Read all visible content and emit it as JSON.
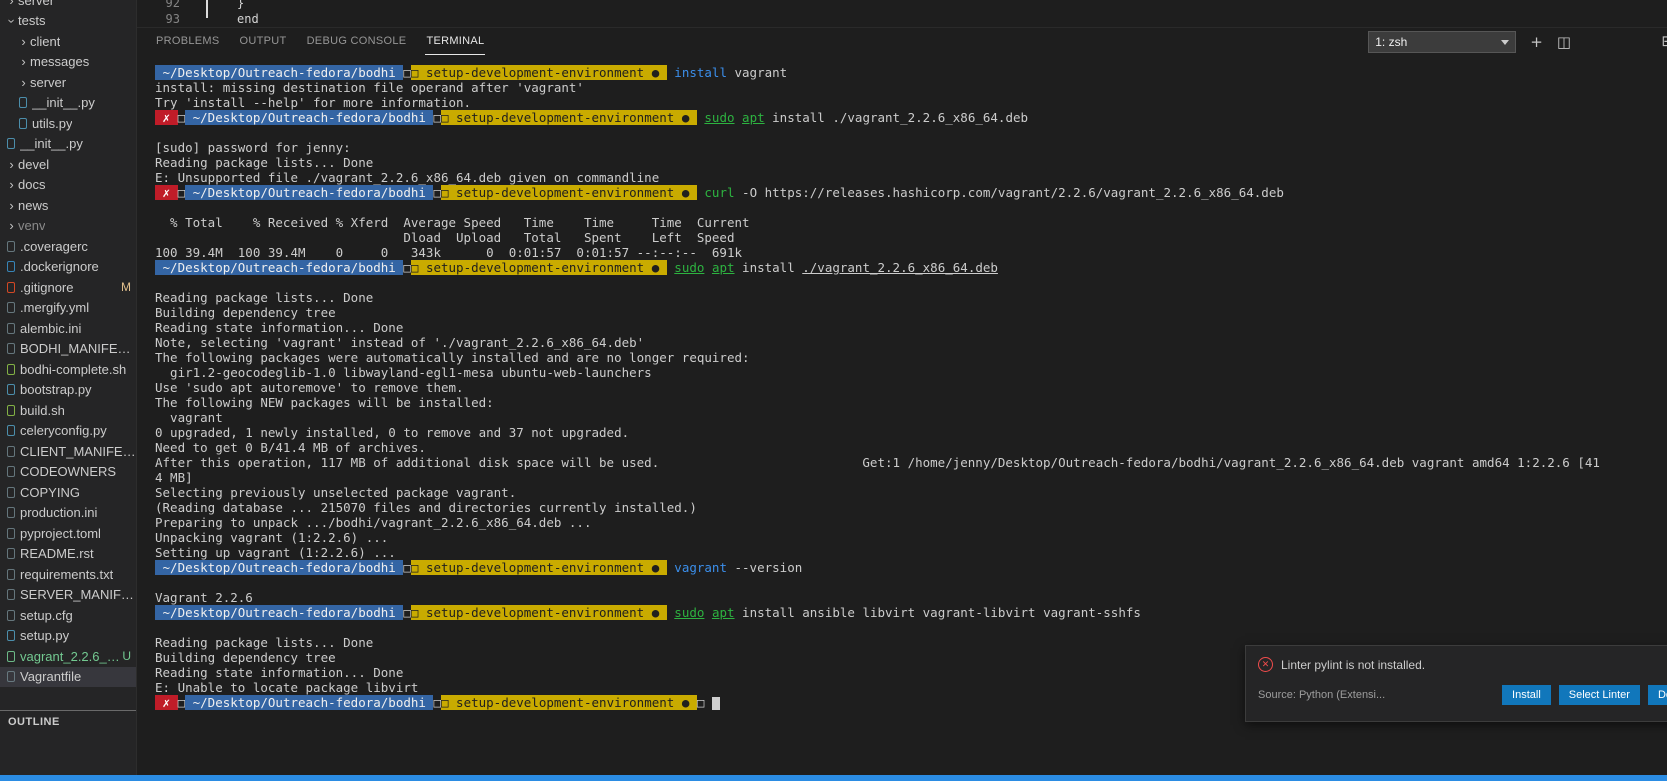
{
  "colors": {
    "prompt_blue": "#3465a4",
    "prompt_yellow": "#c9ab00",
    "prompt_red": "#c01c28",
    "ansi_green": "#2db340",
    "ansi_blue": "#3b8eea",
    "statusbar_blue": "#2b8ce3",
    "button_blue": "#1177bb",
    "error_red": "#f14c4c",
    "git_modified": "#e2c08d",
    "git_untracked": "#73c991"
  },
  "icons": {
    "new_terminal_icon": "+",
    "split_terminal_icon": "◫",
    "maximize_panel_icon": "⊞"
  },
  "sidebar": {
    "outline_label": "OUTLINE",
    "files": [
      {
        "label": "server",
        "kind": "folder",
        "indent": 0
      },
      {
        "label": "tests",
        "kind": "folder",
        "indent": 0,
        "expanded": true
      },
      {
        "label": "client",
        "kind": "folder",
        "indent": 1
      },
      {
        "label": "messages",
        "kind": "folder",
        "indent": 1
      },
      {
        "label": "server",
        "kind": "folder",
        "indent": 1
      },
      {
        "label": "__init__.py",
        "kind": "file",
        "indent": 1,
        "icon": "python-file-icon",
        "icon_color": "#519aba"
      },
      {
        "label": "utils.py",
        "kind": "file",
        "indent": 1,
        "icon": "python-file-icon",
        "icon_color": "#519aba"
      },
      {
        "label": "__init__.py",
        "kind": "file",
        "indent": 0,
        "icon": "python-file-icon",
        "icon_color": "#519aba"
      },
      {
        "label": "devel",
        "kind": "folder",
        "indent": 0
      },
      {
        "label": "docs",
        "kind": "folder",
        "indent": 0
      },
      {
        "label": "news",
        "kind": "folder",
        "indent": 0
      },
      {
        "label": "venv",
        "kind": "folder",
        "indent": 0,
        "dim": true
      },
      {
        "label": ".coveragerc",
        "kind": "file",
        "indent": 0,
        "icon": "config-file-icon",
        "icon_color": "#6d8086"
      },
      {
        "label": ".dockerignore",
        "kind": "file",
        "indent": 0,
        "icon": "docker-icon",
        "icon_color": "#3a8fc6"
      },
      {
        "label": ".gitignore",
        "kind": "file",
        "indent": 0,
        "icon": "git-icon",
        "icon_color": "#e44d26",
        "badge": "M",
        "badge_color": "#e2c08d"
      },
      {
        "label": ".mergify.yml",
        "kind": "file",
        "indent": 0,
        "icon": "yaml-file-icon",
        "icon_color": "#6d8086"
      },
      {
        "label": "alembic.ini",
        "kind": "file",
        "indent": 0,
        "icon": "config-file-icon",
        "icon_color": "#6d8086"
      },
      {
        "label": "BODHI_MANIFEST.in",
        "kind": "file",
        "indent": 0,
        "icon": "text-file-icon",
        "icon_color": "#6d8086"
      },
      {
        "label": "bodhi-complete.sh",
        "kind": "file",
        "indent": 0,
        "icon": "shell-script-icon",
        "icon_color": "#8dc149"
      },
      {
        "label": "bootstrap.py",
        "kind": "file",
        "indent": 0,
        "icon": "python-file-icon",
        "icon_color": "#519aba"
      },
      {
        "label": "build.sh",
        "kind": "file",
        "indent": 0,
        "icon": "shell-script-icon",
        "icon_color": "#8dc149"
      },
      {
        "label": "celeryconfig.py",
        "kind": "file",
        "indent": 0,
        "icon": "python-file-icon",
        "icon_color": "#519aba"
      },
      {
        "label": "CLIENT_MANIFEST.in",
        "kind": "file",
        "indent": 0,
        "icon": "text-file-icon",
        "icon_color": "#6d8086"
      },
      {
        "label": "CODEOWNERS",
        "kind": "file",
        "indent": 0,
        "icon": "text-file-icon",
        "icon_color": "#6d8086"
      },
      {
        "label": "COPYING",
        "kind": "file",
        "indent": 0,
        "icon": "text-file-icon",
        "icon_color": "#6d8086"
      },
      {
        "label": "production.ini",
        "kind": "file",
        "indent": 0,
        "icon": "config-file-icon",
        "icon_color": "#6d8086"
      },
      {
        "label": "pyproject.toml",
        "kind": "file",
        "indent": 0,
        "icon": "config-file-icon",
        "icon_color": "#6d8086"
      },
      {
        "label": "README.rst",
        "kind": "file",
        "indent": 0,
        "icon": "text-file-icon",
        "icon_color": "#6d8086"
      },
      {
        "label": "requirements.txt",
        "kind": "file",
        "indent": 0,
        "icon": "text-file-icon",
        "icon_color": "#6d8086"
      },
      {
        "label": "SERVER_MANIFEST.in",
        "kind": "file",
        "indent": 0,
        "icon": "text-file-icon",
        "icon_color": "#6d8086"
      },
      {
        "label": "setup.cfg",
        "kind": "file",
        "indent": 0,
        "icon": "config-file-icon",
        "icon_color": "#6d8086"
      },
      {
        "label": "setup.py",
        "kind": "file",
        "indent": 0,
        "icon": "python-file-icon",
        "icon_color": "#519aba"
      },
      {
        "label": "vagrant_2.2.6_x...",
        "kind": "file",
        "indent": 0,
        "icon": "package-file-icon",
        "icon_color": "#73c991",
        "badge": "U",
        "badge_color": "#73c991",
        "color": "#73c991"
      },
      {
        "label": "Vagrantfile",
        "kind": "file",
        "indent": 0,
        "icon": "ruby-file-icon",
        "icon_color": "#6d8086",
        "selected": true
      }
    ]
  },
  "editor": {
    "lines": [
      {
        "num": "92",
        "text": "}"
      },
      {
        "num": "93",
        "text": "end"
      }
    ]
  },
  "panel": {
    "tabs": [
      "PROBLEMS",
      "OUTPUT",
      "DEBUG CONSOLE",
      "TERMINAL"
    ],
    "active_tab": "TERMINAL",
    "shell_selector": "1: zsh"
  },
  "terminal": {
    "lines": [
      {
        "spans": [
          {
            "c": "b",
            "t": " ~/Desktop/Outreach-fedora/bodhi "
          },
          {
            "c": "p",
            "t": "□"
          },
          {
            "c": "y",
            "t": "□ setup-development-environment ● "
          },
          {
            "c": "p",
            "t": " "
          },
          {
            "c": "blu",
            "t": "install"
          },
          {
            "c": "p",
            "t": " vagrant"
          }
        ]
      },
      {
        "spans": [
          {
            "c": "p",
            "t": "install: missing destination file operand after 'vagrant'"
          }
        ]
      },
      {
        "spans": [
          {
            "c": "p",
            "t": "Try 'install --help' for more information."
          }
        ]
      },
      {
        "spans": [
          {
            "c": "r",
            "t": " ✗ "
          },
          {
            "c": "p",
            "t": "□"
          },
          {
            "c": "b",
            "t": " ~/Desktop/Outreach-fedora/bodhi "
          },
          {
            "c": "p",
            "t": "□"
          },
          {
            "c": "y",
            "t": "□ setup-development-environment ● "
          },
          {
            "c": "p",
            "t": " "
          },
          {
            "c": "grnU",
            "t": "sudo"
          },
          {
            "c": "p",
            "t": " "
          },
          {
            "c": "grnU",
            "t": "apt"
          },
          {
            "c": "p",
            "t": " install ./vagrant_2.2.6_x86_64.deb"
          }
        ]
      },
      {
        "spans": []
      },
      {
        "spans": [
          {
            "c": "p",
            "t": "[sudo] password for jenny: "
          }
        ]
      },
      {
        "spans": [
          {
            "c": "p",
            "t": "Reading package lists... Done"
          }
        ]
      },
      {
        "spans": [
          {
            "c": "p",
            "t": "E: Unsupported file ./vagrant_2.2.6_x86_64.deb given on commandline"
          }
        ]
      },
      {
        "spans": [
          {
            "c": "r",
            "t": " ✗ "
          },
          {
            "c": "p",
            "t": "□"
          },
          {
            "c": "b",
            "t": " ~/Desktop/Outreach-fedora/bodhi "
          },
          {
            "c": "p",
            "t": "□"
          },
          {
            "c": "y",
            "t": "□ setup-development-environment ● "
          },
          {
            "c": "p",
            "t": " "
          },
          {
            "c": "grn",
            "t": "curl"
          },
          {
            "c": "p",
            "t": " -O https://releases.hashicorp.com/vagrant/2.2.6/vagrant_2.2.6_x86_64.deb"
          }
        ]
      },
      {
        "spans": []
      },
      {
        "spans": [
          {
            "c": "p",
            "t": "  % Total    % Received % Xferd  Average Speed   Time    Time     Time  Current"
          }
        ]
      },
      {
        "spans": [
          {
            "c": "p",
            "t": "                                 Dload  Upload   Total   Spent    Left  Speed"
          }
        ]
      },
      {
        "spans": [
          {
            "c": "p",
            "t": "100 39.4M  100 39.4M    0     0   343k      0  0:01:57  0:01:57 --:--:--  691k"
          }
        ]
      },
      {
        "spans": [
          {
            "c": "b",
            "t": " ~/Desktop/Outreach-fedora/bodhi "
          },
          {
            "c": "p",
            "t": "□"
          },
          {
            "c": "y",
            "t": "□ setup-development-environment ● "
          },
          {
            "c": "p",
            "t": " "
          },
          {
            "c": "grnU",
            "t": "sudo"
          },
          {
            "c": "p",
            "t": " "
          },
          {
            "c": "grnU",
            "t": "apt"
          },
          {
            "c": "p",
            "t": " install "
          },
          {
            "c": "pU",
            "t": "./vagrant_2.2.6_x86_64.deb"
          }
        ]
      },
      {
        "spans": []
      },
      {
        "spans": [
          {
            "c": "p",
            "t": "Reading package lists... Done"
          }
        ]
      },
      {
        "spans": [
          {
            "c": "p",
            "t": "Building dependency tree"
          }
        ]
      },
      {
        "spans": [
          {
            "c": "p",
            "t": "Reading state information... Done"
          }
        ]
      },
      {
        "spans": [
          {
            "c": "p",
            "t": "Note, selecting 'vagrant' instead of './vagrant_2.2.6_x86_64.deb'"
          }
        ]
      },
      {
        "spans": [
          {
            "c": "p",
            "t": "The following packages were automatically installed and are no longer required:"
          }
        ]
      },
      {
        "spans": [
          {
            "c": "p",
            "t": "  gir1.2-geocodeglib-1.0 libwayland-egl1-mesa ubuntu-web-launchers"
          }
        ]
      },
      {
        "spans": [
          {
            "c": "p",
            "t": "Use 'sudo apt autoremove' to remove them."
          }
        ]
      },
      {
        "spans": [
          {
            "c": "p",
            "t": "The following NEW packages will be installed:"
          }
        ]
      },
      {
        "spans": [
          {
            "c": "p",
            "t": "  vagrant"
          }
        ]
      },
      {
        "spans": [
          {
            "c": "p",
            "t": "0 upgraded, 1 newly installed, 0 to remove and 37 not upgraded."
          }
        ]
      },
      {
        "spans": [
          {
            "c": "p",
            "t": "Need to get 0 B/41.4 MB of archives."
          }
        ]
      },
      {
        "spans": [
          {
            "c": "p",
            "t": "After this operation, 117 MB of additional disk space will be used.                           Get:1 /home/jenny/Desktop/Outreach-fedora/bodhi/vagrant_2.2.6_x86_64.deb vagrant amd64 1:2.2.6 [41"
          }
        ]
      },
      {
        "spans": [
          {
            "c": "p",
            "t": "4 MB]"
          }
        ]
      },
      {
        "spans": [
          {
            "c": "p",
            "t": "Selecting previously unselected package vagrant."
          }
        ]
      },
      {
        "spans": [
          {
            "c": "p",
            "t": "(Reading database ... 215070 files and directories currently installed.)"
          }
        ]
      },
      {
        "spans": [
          {
            "c": "p",
            "t": "Preparing to unpack .../bodhi/vagrant_2.2.6_x86_64.deb ..."
          }
        ]
      },
      {
        "spans": [
          {
            "c": "p",
            "t": "Unpacking vagrant (1:2.2.6) ..."
          }
        ]
      },
      {
        "spans": [
          {
            "c": "p",
            "t": "Setting up vagrant (1:2.2.6) ..."
          }
        ]
      },
      {
        "spans": [
          {
            "c": "b",
            "t": " ~/Desktop/Outreach-fedora/bodhi "
          },
          {
            "c": "p",
            "t": "□"
          },
          {
            "c": "y",
            "t": "□ setup-development-environment ● "
          },
          {
            "c": "p",
            "t": " "
          },
          {
            "c": "blu",
            "t": "vagrant"
          },
          {
            "c": "p",
            "t": " --version"
          }
        ]
      },
      {
        "spans": []
      },
      {
        "spans": [
          {
            "c": "p",
            "t": "Vagrant 2.2.6"
          }
        ]
      },
      {
        "spans": [
          {
            "c": "b",
            "t": " ~/Desktop/Outreach-fedora/bodhi "
          },
          {
            "c": "p",
            "t": "□"
          },
          {
            "c": "y",
            "t": "□ setup-development-environment ● "
          },
          {
            "c": "p",
            "t": " "
          },
          {
            "c": "grnU",
            "t": "sudo"
          },
          {
            "c": "p",
            "t": " "
          },
          {
            "c": "grnU",
            "t": "apt"
          },
          {
            "c": "p",
            "t": " install ansible libvirt vagrant-libvirt vagrant-sshfs"
          }
        ]
      },
      {
        "spans": []
      },
      {
        "spans": [
          {
            "c": "p",
            "t": "Reading package lists... Done"
          }
        ]
      },
      {
        "spans": [
          {
            "c": "p",
            "t": "Building dependency tree"
          }
        ]
      },
      {
        "spans": [
          {
            "c": "p",
            "t": "Reading state information... Done"
          }
        ]
      },
      {
        "spans": [
          {
            "c": "p",
            "t": "E: Unable to locate package libvirt"
          }
        ]
      },
      {
        "spans": [
          {
            "c": "r",
            "t": " ✗ "
          },
          {
            "c": "p",
            "t": "□"
          },
          {
            "c": "b",
            "t": " ~/Desktop/Outreach-fedora/bodhi "
          },
          {
            "c": "p",
            "t": "□"
          },
          {
            "c": "y",
            "t": "□ setup-development-environment ● "
          },
          {
            "c": "p",
            "t": "□ "
          },
          {
            "c": "cur",
            "t": " "
          }
        ]
      }
    ]
  },
  "notification": {
    "message": "Linter pylint is not installed.",
    "source": "Source: Python (Extensi...",
    "buttons": [
      "Install",
      "Select Linter",
      "Do"
    ]
  }
}
